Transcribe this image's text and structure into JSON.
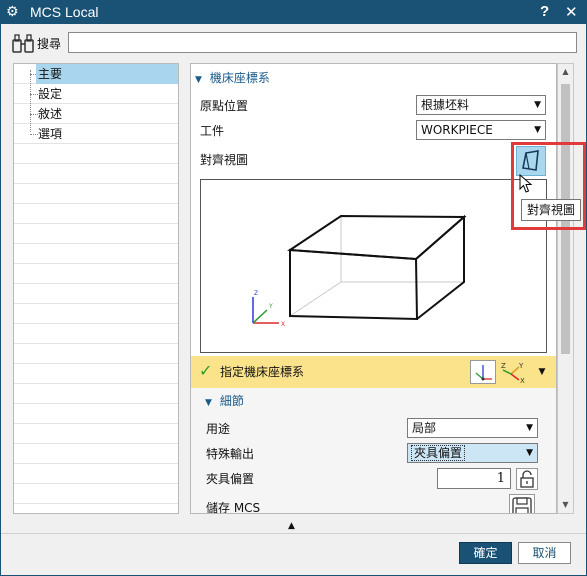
{
  "window": {
    "title": "MCS Local",
    "help_label": "?",
    "close_label": "✕"
  },
  "search": {
    "label": "搜尋",
    "value": ""
  },
  "tree": {
    "items": [
      {
        "label": "主要",
        "selected": true
      },
      {
        "label": "設定",
        "selected": false
      },
      {
        "label": "敘述",
        "selected": false
      },
      {
        "label": "選項",
        "selected": false
      }
    ]
  },
  "machine_csys": {
    "header": "機床座標系",
    "origin_label": "原點位置",
    "origin_value": "根據坯料",
    "workpiece_label": "工件",
    "workpiece_value": "WORKPIECE",
    "orient_view_label": "對齊視圖",
    "specify_label": "指定機床座標系",
    "axis_labels": {
      "z": "Z",
      "y": "Y",
      "x": "X"
    }
  },
  "details": {
    "header": "細節",
    "purpose_label": "用途",
    "purpose_value": "局部",
    "special_output_label": "特殊輸出",
    "special_output_value": "夾具偏置",
    "fixture_offset_label": "夾具偏置",
    "fixture_offset_value": "1",
    "save_mcs_label": "儲存 MCS"
  },
  "tooltip": {
    "text": "對齊視圖"
  },
  "footer": {
    "ok_label": "確定",
    "cancel_label": "取消"
  },
  "colors": {
    "titlebar": "#1a5276",
    "accent": "#1a5b8a",
    "highlight": "#e03a3a",
    "specify_bar": "#fbe38c",
    "selection": "#a9d6ee"
  }
}
